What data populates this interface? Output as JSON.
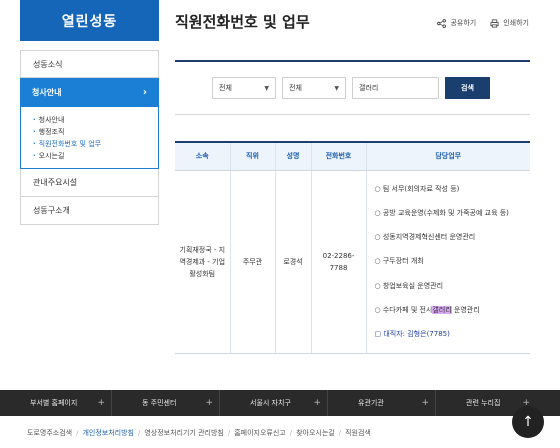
{
  "sidebar": {
    "title": "열린성동",
    "items_before": [
      "성동소식"
    ],
    "active": "청사안내",
    "active_chevron": "›",
    "sub_items": [
      "청사안내",
      "행정조직",
      "직원전화번호 및 업무",
      "오시는길"
    ],
    "items_after": [
      "관내주요시설",
      "성동구소개"
    ]
  },
  "header": {
    "title": "직원전화번호 및 업무",
    "share": "공유하기",
    "print": "인쇄하기"
  },
  "search": {
    "select1": "전체",
    "select2": "전체",
    "query": "갤러리",
    "button": "검색"
  },
  "table": {
    "headers": [
      "소속",
      "직위",
      "성명",
      "전화번호",
      "담당업무"
    ],
    "row": {
      "dept": "기획재정국 - 지역경제과 - 기업활성화팀",
      "position": "주무관",
      "name": "로경석",
      "phone": "02-2286-7788",
      "duties": [
        "팀 서무(회의자료 작성 등)",
        "공방 교육운영(수제화 및 가죽공예 교육 등)",
        "성동지역경제혁신센터 운영관리",
        "구두장터 개최",
        "창업보육실 운영관리"
      ],
      "duty_hl_pre": "수다카페 및 전시",
      "duty_hl": "갤러리",
      "duty_hl_post": " 운영관리",
      "contact": "대직자: 김형은(7785)"
    }
  },
  "footer": {
    "nav": [
      "부서별 홈페이지",
      "동 주민센터",
      "서울시 자치구",
      "유관기관",
      "관련 누리집"
    ],
    "nav_plus": "+",
    "links": [
      "도로명주소검색",
      "개인정보처리방침",
      "영상정보처리기기 관리방침",
      "홈페이지오류신고",
      "찾아오시는길",
      "직원검색"
    ],
    "link_sep": "/",
    "top_arrow": "↑"
  }
}
